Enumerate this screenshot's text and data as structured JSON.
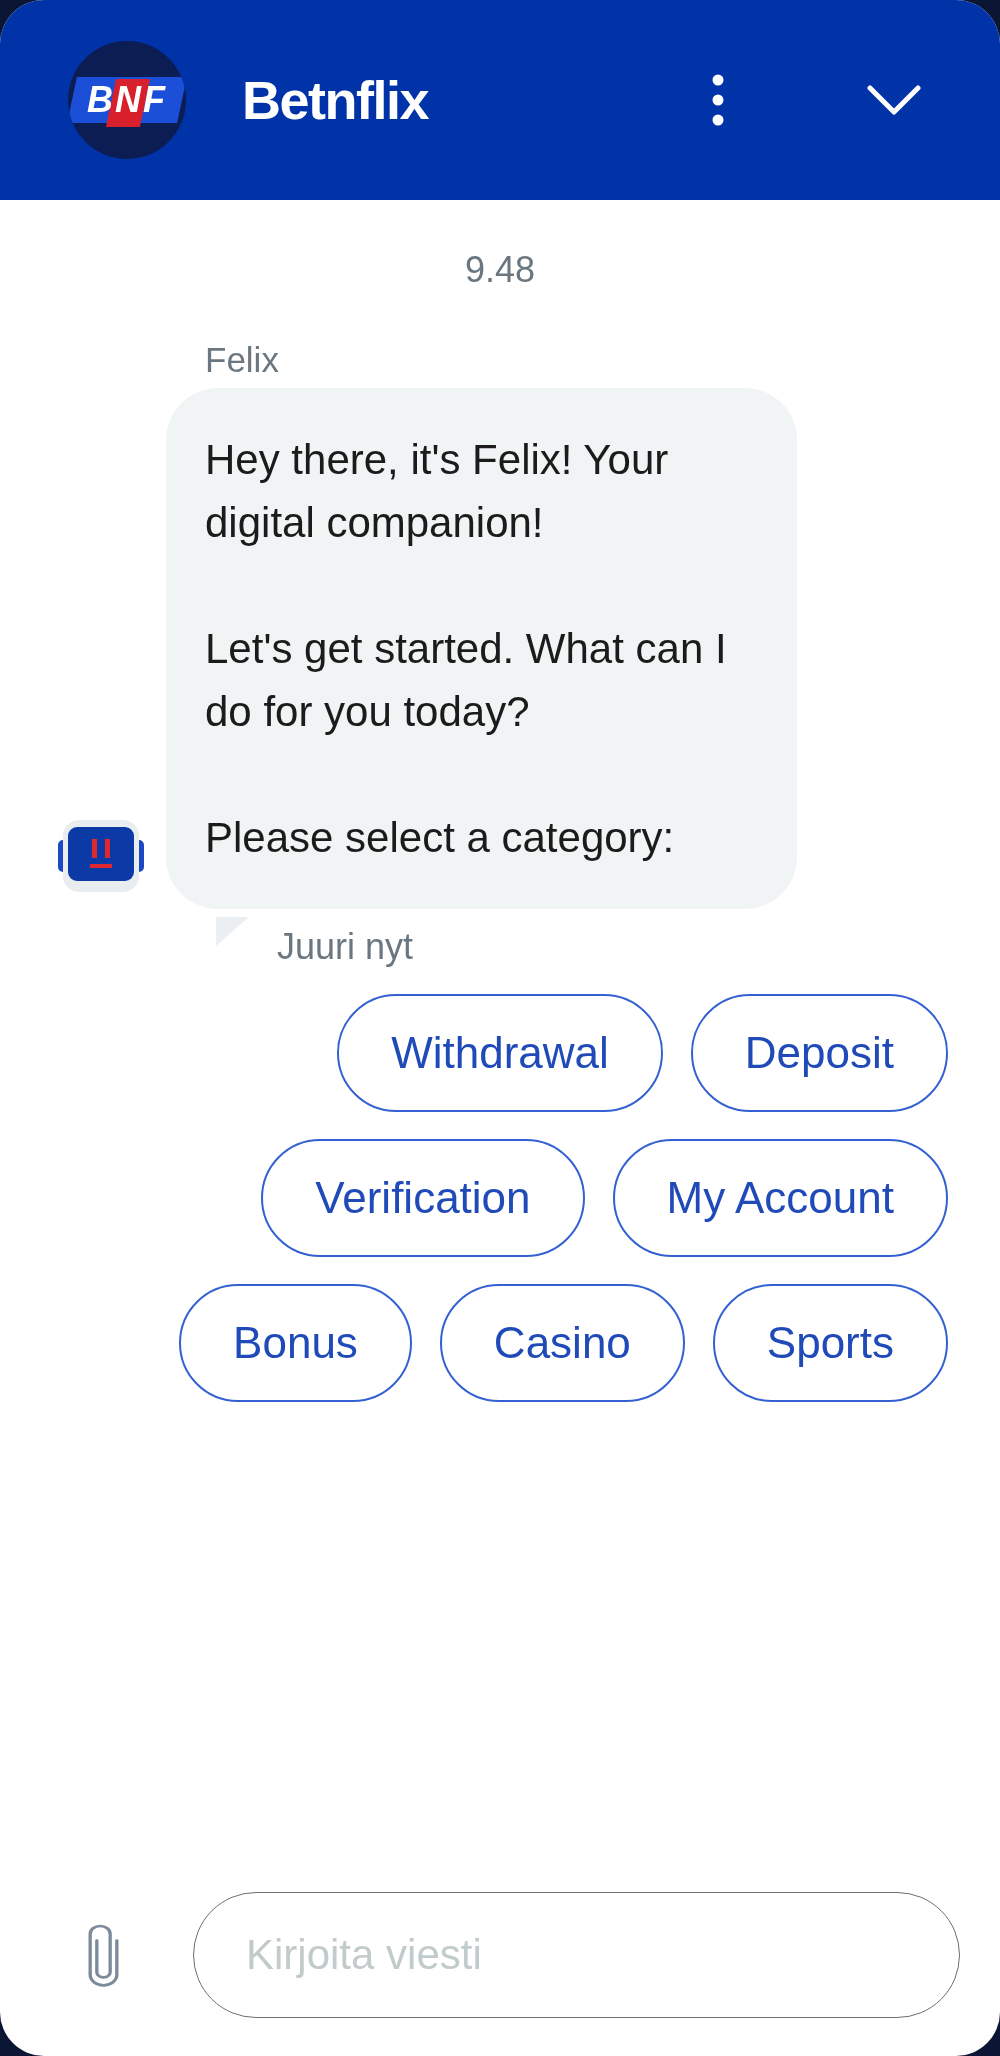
{
  "header": {
    "logo": "BNF",
    "title": "Betnflix"
  },
  "conversation": {
    "timestamp": "9.48",
    "messages": [
      {
        "sender": "Felix",
        "paragraphs": [
          "Hey there, it's Felix! Your digital companion!",
          "Let's get started. What can I do for you today?",
          "Please select a category:"
        ],
        "time": "Juuri nyt"
      }
    ]
  },
  "quick_replies": [
    "Withdrawal",
    "Deposit",
    "Verification",
    "My Account",
    "Bonus",
    "Casino",
    "Sports"
  ],
  "composer": {
    "placeholder": "Kirjoita viesti"
  }
}
